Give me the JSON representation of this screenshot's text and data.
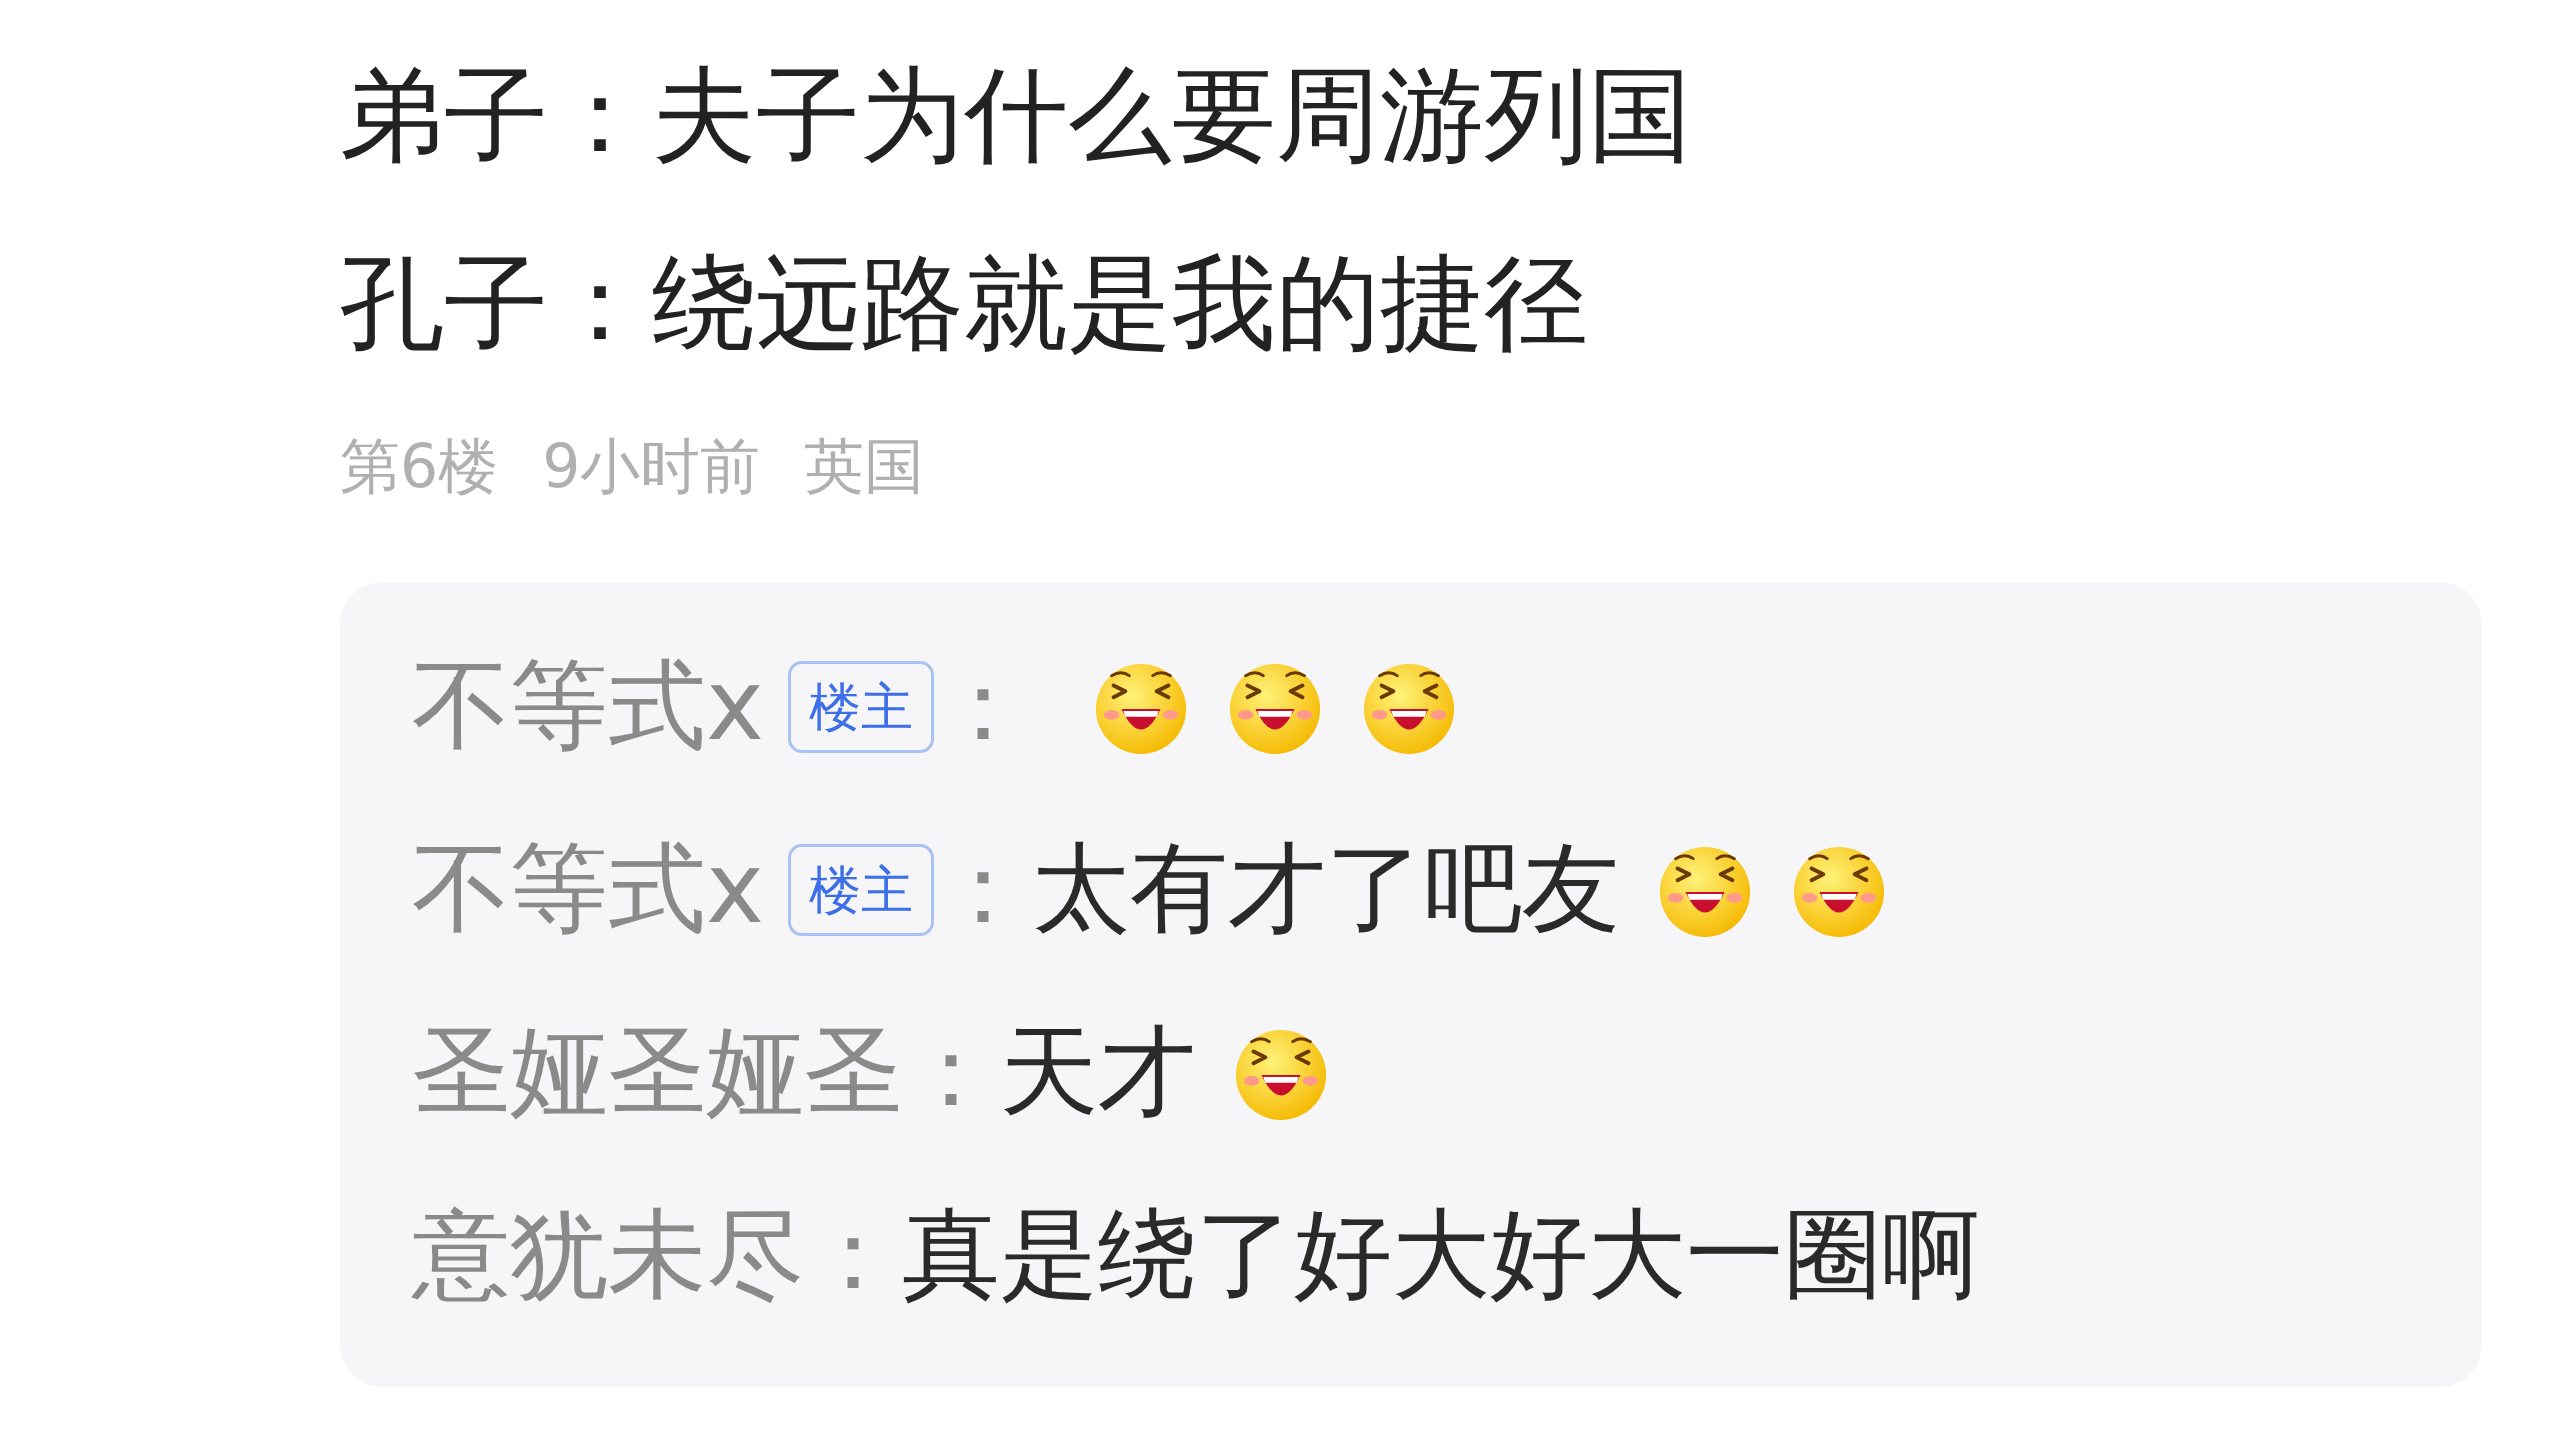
{
  "post": {
    "lines": [
      "弟子：夫子为什么要周游列国",
      "孔子：绕远路就是我的捷径"
    ],
    "meta": [
      "第6楼",
      "9小时前",
      "英国"
    ]
  },
  "replies": [
    {
      "author": "不等式x",
      "badge": "楼主",
      "separator": "：",
      "content": [
        {
          "kind": "emoji"
        },
        {
          "kind": "emoji"
        },
        {
          "kind": "emoji"
        }
      ]
    },
    {
      "author": "不等式x",
      "badge": "楼主",
      "separator": "：",
      "content": [
        {
          "kind": "text",
          "text": "太有才了吧友"
        },
        {
          "kind": "emoji"
        },
        {
          "kind": "emoji"
        }
      ]
    },
    {
      "author": "圣娅圣娅圣",
      "separator": "：",
      "content": [
        {
          "kind": "text",
          "text": "天才"
        },
        {
          "kind": "emoji"
        }
      ]
    },
    {
      "author": "意犹未尽",
      "separator": "：",
      "content": [
        {
          "kind": "text",
          "text": "真是绕了好大好大一圈啊"
        }
      ]
    }
  ]
}
